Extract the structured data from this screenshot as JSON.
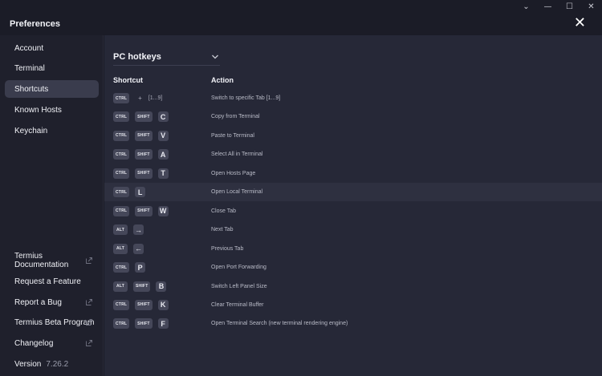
{
  "window": {
    "title": "Preferences",
    "controls": [
      "⌄",
      "—",
      "☐",
      "✕"
    ],
    "close_glyph": "✕"
  },
  "sidebar": {
    "items": [
      {
        "label": "Account"
      },
      {
        "label": "Terminal"
      },
      {
        "label": "Shortcuts",
        "active": true
      },
      {
        "label": "Known Hosts"
      },
      {
        "label": "Keychain"
      }
    ],
    "links": [
      {
        "label": "Termius Documentation",
        "external": true
      },
      {
        "label": "Request a Feature",
        "external": false
      },
      {
        "label": "Report a Bug",
        "external": true
      },
      {
        "label": "Termius Beta Program",
        "external": true
      },
      {
        "label": "Changelog",
        "external": true
      }
    ],
    "version_label": "Version",
    "version_value": "7.26.2"
  },
  "main": {
    "dropdown_value": "PC hotkeys",
    "col_shortcut": "Shortcut",
    "col_action": "Action",
    "highlighted_row": 5,
    "shortcuts": [
      {
        "keys": [
          "CTRL"
        ],
        "plus": "+",
        "range": "[1...9]",
        "action": "Switch to specific Tab [1...9]"
      },
      {
        "keys": [
          "CTRL",
          "SHIFT",
          "C"
        ],
        "action": "Copy from Terminal"
      },
      {
        "keys": [
          "CTRL",
          "SHIFT",
          "V"
        ],
        "action": "Paste to Terminal"
      },
      {
        "keys": [
          "CTRL",
          "SHIFT",
          "A"
        ],
        "action": "Select All in Terminal"
      },
      {
        "keys": [
          "CTRL",
          "SHIFT",
          "T"
        ],
        "action": "Open Hosts Page"
      },
      {
        "keys": [
          "CTRL",
          "L"
        ],
        "action": "Open Local Terminal"
      },
      {
        "keys": [
          "CTRL",
          "SHIFT",
          "W"
        ],
        "action": "Close Tab"
      },
      {
        "keys": [
          "ALT",
          "→"
        ],
        "action": "Next Tab"
      },
      {
        "keys": [
          "ALT",
          "←"
        ],
        "action": "Previous Tab"
      },
      {
        "keys": [
          "CTRL",
          "P"
        ],
        "action": "Open Port Forwarding"
      },
      {
        "keys": [
          "ALT",
          "SHIFT",
          "B"
        ],
        "action": "Switch Left Panel Size"
      },
      {
        "keys": [
          "CTRL",
          "SHIFT",
          "K"
        ],
        "action": "Clear Terminal Buffer"
      },
      {
        "keys": [
          "CTRL",
          "SHIFT",
          "F"
        ],
        "action": "Open Terminal Search (new terminal rendering engine)"
      }
    ]
  },
  "colors": {
    "sidebar_bg": "#1f202c",
    "main_bg": "#262837",
    "active_item_bg": "#3a3c4d",
    "key_bg": "#454759"
  }
}
